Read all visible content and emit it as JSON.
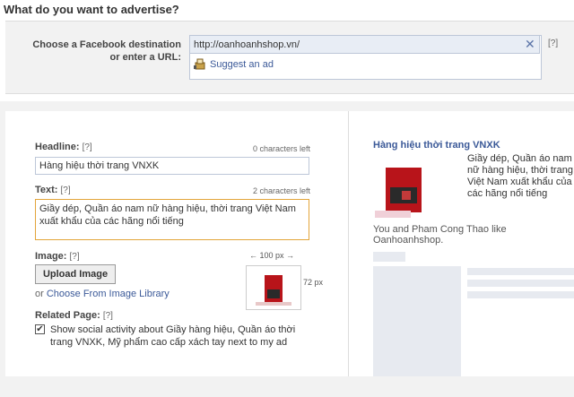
{
  "page": {
    "title": "What do you want to advertise?"
  },
  "destination": {
    "label_line1": "Choose a Facebook destination",
    "label_line2": "or enter a URL:",
    "url_value": "http://oanhoanhshop.vn/",
    "clear_symbol": "✕",
    "help": "[?]",
    "suggest_label": "Suggest an ad"
  },
  "headline": {
    "label": "Headline:",
    "help": "[?]",
    "count": "0 characters left",
    "value": "Hàng hiệu thời trang VNXK"
  },
  "text": {
    "label": "Text:",
    "help": "[?]",
    "count": "2 characters left",
    "value": "Giầy dép, Quần áo nam nữ hàng hiệu, thời trang Việt Nam xuất khẩu của các hãng nổi tiếng"
  },
  "image": {
    "label": "Image:",
    "help": "[?]",
    "upload_label": "Upload Image",
    "or_label": "or",
    "library_label": "Choose From Image Library",
    "width_label": "100 px",
    "height_label": "72 px"
  },
  "related": {
    "label": "Related Page:",
    "help": "[?]",
    "checked": true,
    "text": "Show social activity about Giầy hàng hiệu, Quần áo thời trang VNXK, Mỹ phẩm cao cấp xách tay next to my ad"
  },
  "preview": {
    "title": "Hàng hiệu thời trang VNXK",
    "body": "Giầy dép, Quần áo nam nữ hàng hiệu, thời trang Việt Nam xuất khẩu của các hãng nổi tiếng",
    "social": "You and Pham Cong Thao like Oanhoanhshop."
  },
  "colors": {
    "link": "#3b5998",
    "focus_border": "#e3a53a",
    "panel_bg": "#f2f2f2"
  }
}
